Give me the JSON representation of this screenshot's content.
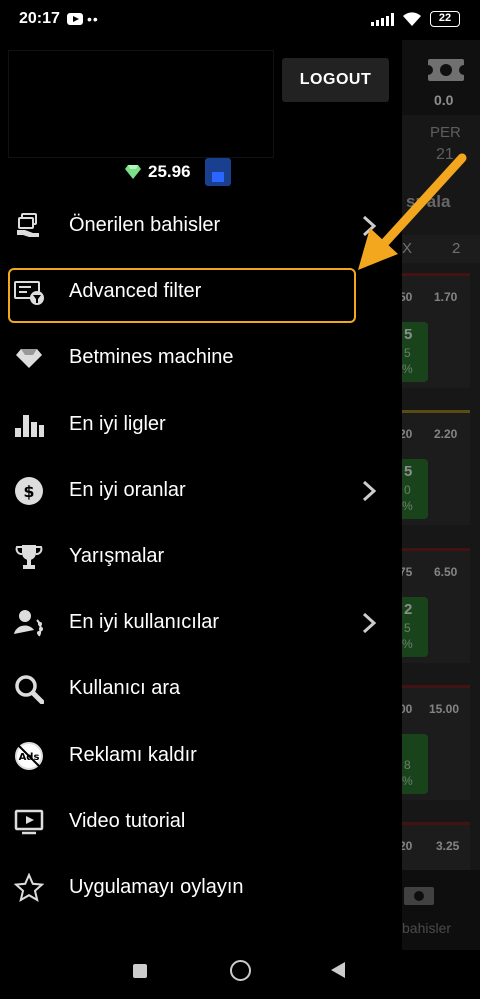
{
  "status_bar": {
    "time": "20:17",
    "battery": "22"
  },
  "background_app": {
    "score": "0.0",
    "per_label": "PER",
    "per_value": "21",
    "sort_label": "sırala",
    "col_x": "X",
    "col_2": "2",
    "cards": [
      {
        "odd_a": "50",
        "odd_b": "1.70",
        "green_a": "5",
        "green_b": "5",
        "green_c": "%"
      },
      {
        "odd_a": "20",
        "odd_b": "2.20",
        "green_a": "5",
        "green_b": "0",
        "green_c": "%"
      },
      {
        "odd_a": "75",
        "odd_b": "6.50",
        "green_a": "2",
        "green_b": "5",
        "green_c": "%"
      },
      {
        "odd_a": "00",
        "odd_b": "15.00",
        "green_a": "",
        "green_b": "8",
        "green_c": "%"
      },
      {
        "odd_a": "20",
        "odd_b": "3.25",
        "green_a": "",
        "green_b": "",
        "green_c": ""
      }
    ],
    "bottom_label": "bahisler"
  },
  "drawer": {
    "logout_label": "LOGOUT",
    "balance": "25.96",
    "menu": [
      {
        "label": "Önerilen bahisler",
        "icon": "money-hand-icon",
        "chevron": true
      },
      {
        "label": "Advanced filter",
        "icon": "filter-icon",
        "chevron": false
      },
      {
        "label": "Betmines machine",
        "icon": "diamond-icon",
        "chevron": false
      },
      {
        "label": "En iyi ligler",
        "icon": "bar-chart-icon",
        "chevron": false
      },
      {
        "label": "En iyi oranlar",
        "icon": "money-bag-icon",
        "chevron": true
      },
      {
        "label": "Yarışmalar",
        "icon": "trophy-icon",
        "chevron": false
      },
      {
        "label": "En iyi kullanıcılar",
        "icon": "user-laurel-icon",
        "chevron": true
      },
      {
        "label": "Kullanıcı ara",
        "icon": "search-icon",
        "chevron": false
      },
      {
        "label": "Reklamı kaldır",
        "icon": "no-ads-icon",
        "chevron": false
      },
      {
        "label": "Video tutorial",
        "icon": "video-icon",
        "chevron": false
      },
      {
        "label": "Uygulamayı oylayın",
        "icon": "star-icon",
        "chevron": false
      }
    ]
  },
  "colors": {
    "highlight": "#f2a71f",
    "arrow": "#f2a71f",
    "diamond": "#7be08a"
  }
}
